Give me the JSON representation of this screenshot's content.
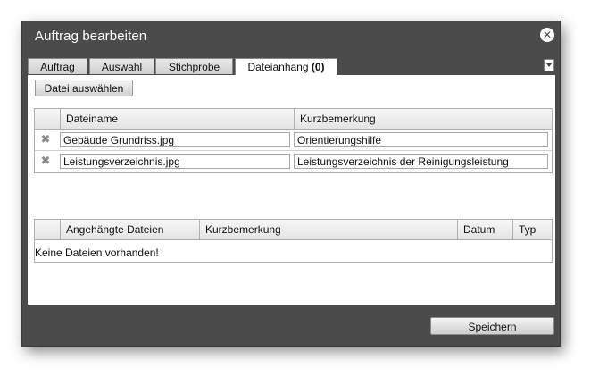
{
  "dialog": {
    "title": "Auftrag bearbeiten",
    "close_symbol": "✕"
  },
  "tabs": [
    {
      "label": "Auftrag"
    },
    {
      "label": "Auswahl"
    },
    {
      "label": "Stichprobe"
    },
    {
      "label": "Dateianhang",
      "count": "(0)"
    }
  ],
  "tab_menu_icon": "chevron-down-icon",
  "toolbar": {
    "select_file_label": "Datei auswählen"
  },
  "upload_grid": {
    "columns": [
      "Dateiname",
      "Kurzbemerkung"
    ],
    "rows": [
      {
        "filename": "Gebäude Grundriss.jpg",
        "note": "Orientierungshilfe"
      },
      {
        "filename": "Leistungsverzeichnis.jpg",
        "note": "Leistungsverzeichnis der Reinigungsleistung"
      }
    ],
    "delete_symbol": "✖"
  },
  "attached_grid": {
    "columns": [
      "Angehängte Dateien",
      "Kurzbemerkung",
      "Datum",
      "Typ"
    ],
    "empty_message": "Keine Dateien vorhanden!"
  },
  "footer": {
    "save_label": "Speichern"
  },
  "colors": {
    "dialog_bg": "#4b4b4b",
    "content_bg": "#ffffff"
  }
}
